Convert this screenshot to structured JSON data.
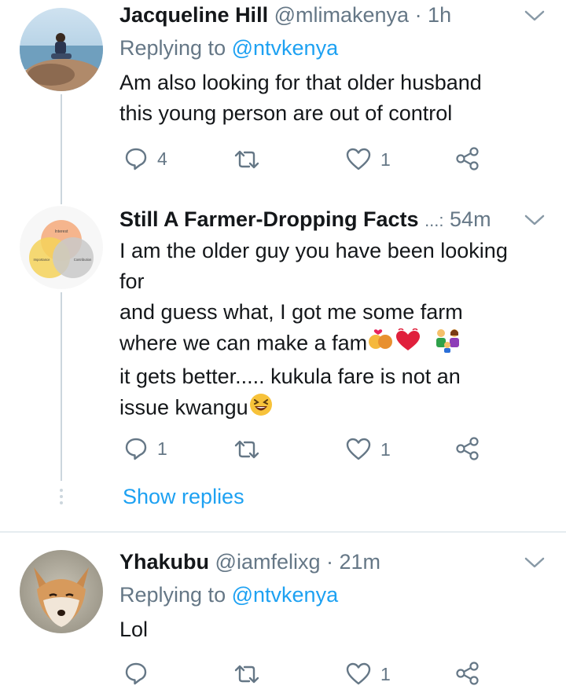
{
  "tweets": [
    {
      "name": "Jacqueline  Hill",
      "handle": "@mlimakenya",
      "time": "· 1h",
      "replying_prefix": "Replying to",
      "replying_handle": "@ntvkenya",
      "lines": [
        "Am also looking for that older husband",
        "this young person are out of control"
      ],
      "reply_count": "4",
      "retweet_count": "",
      "like_count": "1"
    },
    {
      "name": "Still A Farmer-Dropping Facts",
      "ellipsis": "...:",
      "time": "54m",
      "lines": [
        "I am the older guy you have been looking",
        "for",
        "and guess what,  I got me some farm",
        "where we can make a  fam",
        "it gets better..... kukula fare is not an",
        "issue  kwangu"
      ],
      "reply_count": "1",
      "retweet_count": "",
      "like_count": "1",
      "show_replies": "Show replies",
      "avatar_labels": [
        "Interest",
        "Importance",
        "Contribution"
      ]
    },
    {
      "name": "Yhakubu",
      "handle": "@iamfelixg",
      "time": "· 21m",
      "replying_prefix": "Replying to",
      "replying_handle": "@ntvkenya",
      "lines": [
        "Lol"
      ],
      "reply_count": "",
      "retweet_count": "",
      "like_count": "1"
    }
  ],
  "icons": {
    "reply": "reply-icon",
    "retweet": "retweet-icon",
    "like": "heart-icon",
    "share": "share-icon",
    "caret": "chevron-down-icon"
  },
  "colors": {
    "accent": "#1da1f2",
    "secondary_text": "#657786",
    "primary_text": "#14171a"
  }
}
